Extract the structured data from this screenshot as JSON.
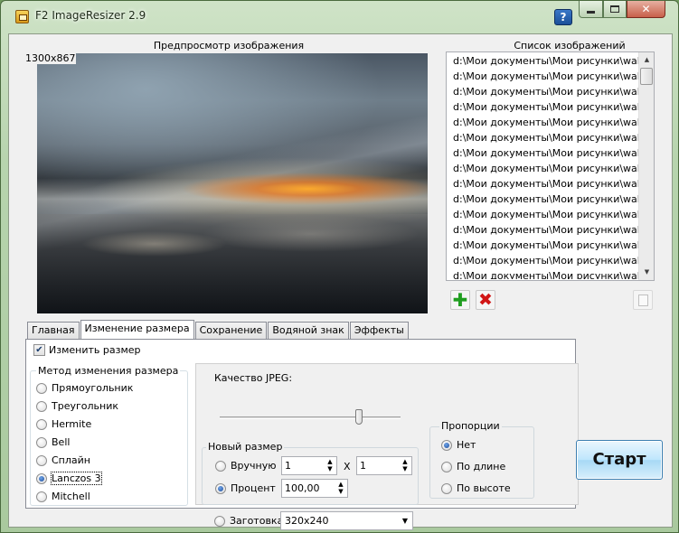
{
  "window": {
    "title": "F2 ImageResizer 2.9",
    "help_label": "?"
  },
  "preview": {
    "title": "Предпросмотр изображения",
    "size_label": "1300x867"
  },
  "image_list": {
    "title": "Список изображений",
    "items": [
      "d:\\Мои документы\\Мои рисунки\\wallp...",
      "d:\\Мои документы\\Мои рисунки\\wallp...",
      "d:\\Мои документы\\Мои рисунки\\wallp...",
      "d:\\Мои документы\\Мои рисунки\\wallp...",
      "d:\\Мои документы\\Мои рисунки\\wallp...",
      "d:\\Мои документы\\Мои рисунки\\wallp...",
      "d:\\Мои документы\\Мои рисунки\\wallp...",
      "d:\\Мои документы\\Мои рисунки\\wallp...",
      "d:\\Мои документы\\Мои рисунки\\wallp...",
      "d:\\Мои документы\\Мои рисунки\\wallp...",
      "d:\\Мои документы\\Мои рисунки\\wallp...",
      "d:\\Мои документы\\Мои рисунки\\wallp...",
      "d:\\Мои документы\\Мои рисунки\\wallp...",
      "d:\\Мои документы\\Мои рисунки\\wallp...",
      "d:\\Мои документы\\Мои рисунки\\wallp..."
    ]
  },
  "tabs": [
    {
      "label": "Главная"
    },
    {
      "label": "Изменение размера"
    },
    {
      "label": "Сохранение"
    },
    {
      "label": "Водяной знак"
    },
    {
      "label": "Эффекты"
    }
  ],
  "resize": {
    "enable_label": "Изменить размер",
    "method_title": "Метод изменения размера",
    "methods": [
      "Прямоугольник",
      "Треугольник",
      "Hermite",
      "Bell",
      "Сплайн",
      "Lanczos 3",
      "Mitchell"
    ],
    "selected_method": "Lanczos 3",
    "jpeg_quality_label": "Качество JPEG:",
    "jpeg_quality_level": 0.77,
    "new_size_title": "Новый размер",
    "manual_label": "Вручную",
    "manual_width": "1",
    "x_label": "X",
    "manual_height": "1",
    "percent_label": "Процент",
    "percent_value": "100,00",
    "preset_label": "Заготовка",
    "preset_value": "320x240",
    "proportions_title": "Пропорции",
    "proportions": [
      "Нет",
      "По длине",
      "По высоте"
    ]
  },
  "start_label": "Старт"
}
